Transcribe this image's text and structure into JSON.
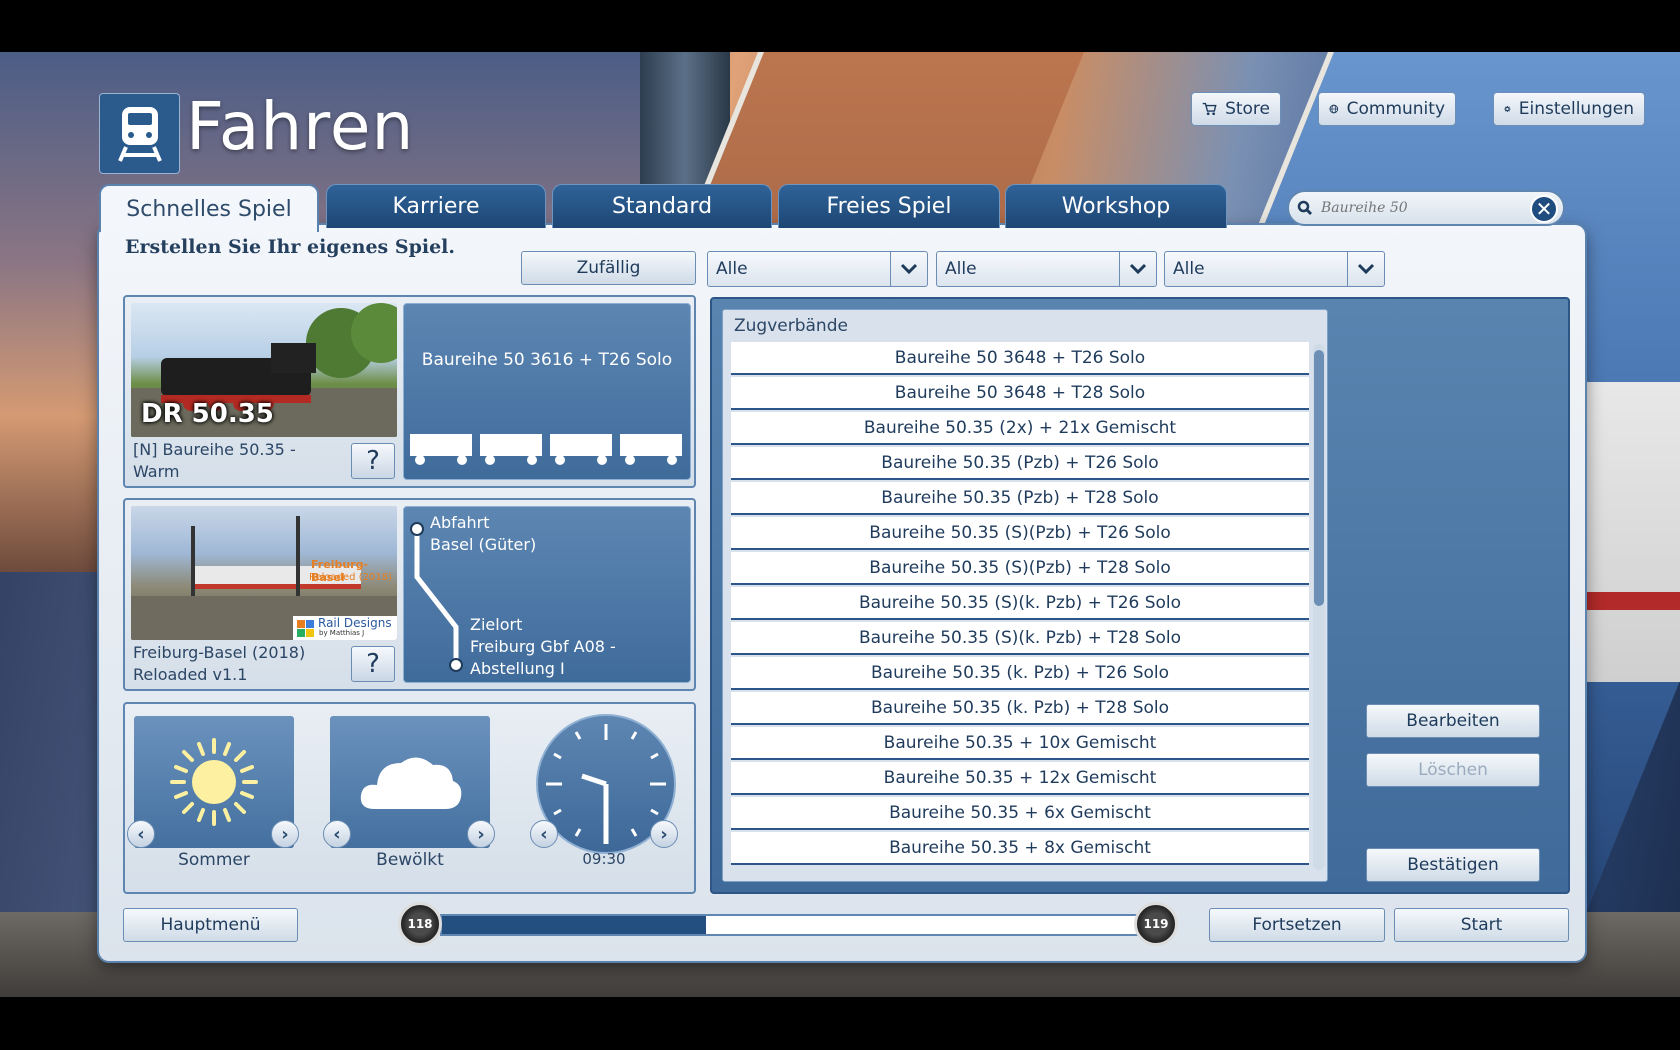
{
  "header": {
    "title": "Fahren",
    "store_label": "Store",
    "community_label": "Community",
    "settings_label": "Einstellungen"
  },
  "tabs": [
    {
      "label": "Schnelles Spiel",
      "active": true
    },
    {
      "label": "Karriere",
      "active": false
    },
    {
      "label": "Standard",
      "active": false
    },
    {
      "label": "Freies Spiel",
      "active": false
    },
    {
      "label": "Workshop",
      "active": false
    }
  ],
  "search": {
    "placeholder": "Baureihe 50"
  },
  "subtitle": "Erstellen Sie Ihr eigenes Spiel.",
  "filters": {
    "random_label": "Zufällig",
    "select1": "Alle",
    "select2": "Alle",
    "select3": "Alle"
  },
  "loco_card": {
    "thumb_caption": "DR 50.35",
    "label_line1": "[N] Baureihe 50.35 -",
    "label_line2": "Warm",
    "consist": "Baureihe 50 3616 + T26  Solo",
    "help": "?"
  },
  "route_card": {
    "label_line1": "Freiburg-Basel (2018)",
    "label_line2": "Reloaded v1.1",
    "thumb_brand": "Rail Designs",
    "thumb_brand_sub": "by Matthias J",
    "thumb_overlay": "Freiburg-Basel",
    "thumb_overlay_sub": "Reloaded (2018)",
    "departure_label": "Abfahrt",
    "departure_place": "Basel (Güter)",
    "destination_label": "Zielort",
    "destination_place_line1": "Freiburg Gbf A08 -",
    "destination_place_line2": "Abstellung I",
    "help": "?"
  },
  "environment": {
    "season": "Sommer",
    "weather": "Bewölkt",
    "time": "09:30"
  },
  "consists": {
    "title": "Zugverbände",
    "items": [
      "Baureihe 50 3648 + T26  Solo",
      "Baureihe 50 3648 + T28  Solo",
      "Baureihe 50.35 (2x) + 21x Gemischt",
      "Baureihe 50.35 (Pzb) + T26  Solo",
      "Baureihe 50.35 (Pzb) + T28  Solo",
      "Baureihe 50.35 (S)(Pzb) + T26  Solo",
      "Baureihe 50.35 (S)(Pzb) + T28  Solo",
      "Baureihe 50.35 (S)(k. Pzb) + T26  Solo",
      "Baureihe 50.35 (S)(k. Pzb) + T28  Solo",
      "Baureihe 50.35 (k. Pzb) + T26  Solo",
      "Baureihe 50.35 (k. Pzb) + T28  Solo",
      "Baureihe 50.35 + 10x Gemischt",
      "Baureihe 50.35 + 12x Gemischt",
      "Baureihe 50.35 + 6x Gemischt",
      "Baureihe 50.35 + 8x Gemischt"
    ],
    "edit_label": "Bearbeiten",
    "delete_label": "Löschen",
    "confirm_label": "Bestätigen"
  },
  "footer": {
    "main_menu_label": "Hauptmenü",
    "level_current": "118",
    "level_next": "119",
    "progress": 0.37,
    "continue_label": "Fortsetzen",
    "start_label": "Start"
  },
  "colors": {
    "accent": "#234f80",
    "tab_dark": "#1d4674",
    "panel": "#e9eef4"
  }
}
